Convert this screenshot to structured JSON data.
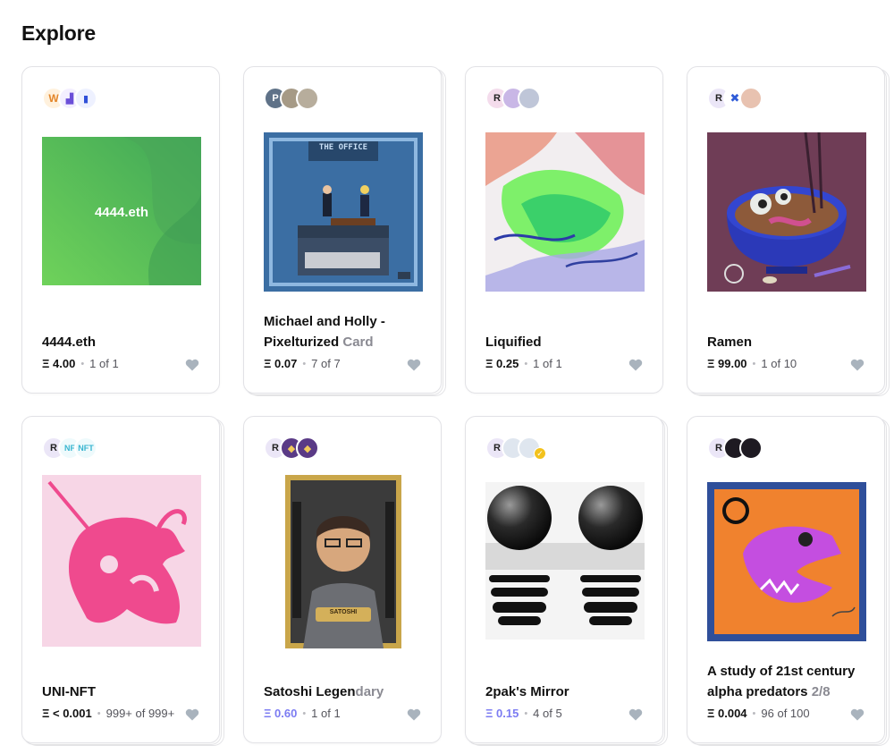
{
  "page": {
    "title": "Explore"
  },
  "currency_symbol": "Ξ",
  "cards": [
    {
      "title": "4444.eth",
      "title_muted": "",
      "price": "4.00",
      "edition": "1 of 1",
      "thumb_label": "4444.eth",
      "highlight_price": false
    },
    {
      "title": "Michael and Holly - Pixelturized ",
      "title_muted": "Card",
      "price": "0.07",
      "edition": "7 of 7",
      "thumb_label": "THE OFFICE",
      "highlight_price": false
    },
    {
      "title": "Liquified",
      "title_muted": "",
      "price": "0.25",
      "edition": "1 of 1",
      "thumb_label": "",
      "highlight_price": false
    },
    {
      "title": "Ramen",
      "title_muted": "",
      "price": "99.00",
      "edition": "1 of 10",
      "thumb_label": "",
      "highlight_price": false
    },
    {
      "title": "UNI-NFT",
      "title_muted": "",
      "price": "< 0.001",
      "edition": "999+ of 999+",
      "thumb_label": "",
      "highlight_price": false
    },
    {
      "title": "Satoshi Legen",
      "title_muted": "dary",
      "price": "0.60",
      "edition": "1 of 1",
      "thumb_label": "SATOSHI",
      "highlight_price": true
    },
    {
      "title": "2pak's Mirror",
      "title_muted": "",
      "price": "0.15",
      "edition": "4 of 5",
      "thumb_label": "",
      "highlight_price": true
    },
    {
      "title": "A study of 21st century alpha predators ",
      "title_muted": "2/8",
      "price": "0.004",
      "edition": "96 of 100",
      "thumb_label": "",
      "highlight_price": false
    }
  ],
  "colors": {
    "accent_price": "#7c7cf2",
    "heart": "#a9b3bd",
    "card_border": "#e2e2e6"
  },
  "icons": {
    "heart": "heart-icon",
    "bitcoin": "bitcoin-icon"
  }
}
